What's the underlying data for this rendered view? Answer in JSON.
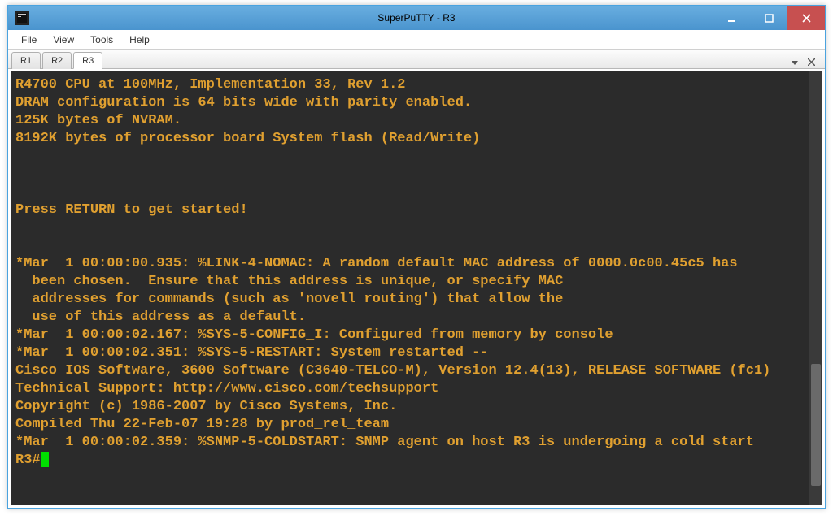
{
  "window": {
    "title": "SuperPuTTY - R3"
  },
  "menu": {
    "items": [
      "File",
      "View",
      "Tools",
      "Help"
    ]
  },
  "tabs": {
    "items": [
      {
        "label": "R1",
        "active": false
      },
      {
        "label": "R2",
        "active": false
      },
      {
        "label": "R3",
        "active": true
      }
    ]
  },
  "terminal": {
    "lines": [
      "R4700 CPU at 100MHz, Implementation 33, Rev 1.2",
      "DRAM configuration is 64 bits wide with parity enabled.",
      "125K bytes of NVRAM.",
      "8192K bytes of processor board System flash (Read/Write)",
      "",
      "",
      "",
      "Press RETURN to get started!",
      "",
      "",
      "*Mar  1 00:00:00.935: %LINK-4-NOMAC: A random default MAC address of 0000.0c00.45c5 has",
      "  been chosen.  Ensure that this address is unique, or specify MAC",
      "  addresses for commands (such as 'novell routing') that allow the",
      "  use of this address as a default.",
      "*Mar  1 00:00:02.167: %SYS-5-CONFIG_I: Configured from memory by console",
      "*Mar  1 00:00:02.351: %SYS-5-RESTART: System restarted --",
      "Cisco IOS Software, 3600 Software (C3640-TELCO-M), Version 12.4(13), RELEASE SOFTWARE (fc1)",
      "Technical Support: http://www.cisco.com/techsupport",
      "Copyright (c) 1986-2007 by Cisco Systems, Inc.",
      "Compiled Thu 22-Feb-07 19:28 by prod_rel_team",
      "*Mar  1 00:00:02.359: %SNMP-5-COLDSTART: SNMP agent on host R3 is undergoing a cold start"
    ],
    "prompt": "R3#"
  },
  "colors": {
    "terminal_bg": "#2b2b2b",
    "terminal_fg": "#e0a030",
    "cursor": "#00e000",
    "close_btn": "#c75050",
    "titlebar": "#4a94ce"
  }
}
